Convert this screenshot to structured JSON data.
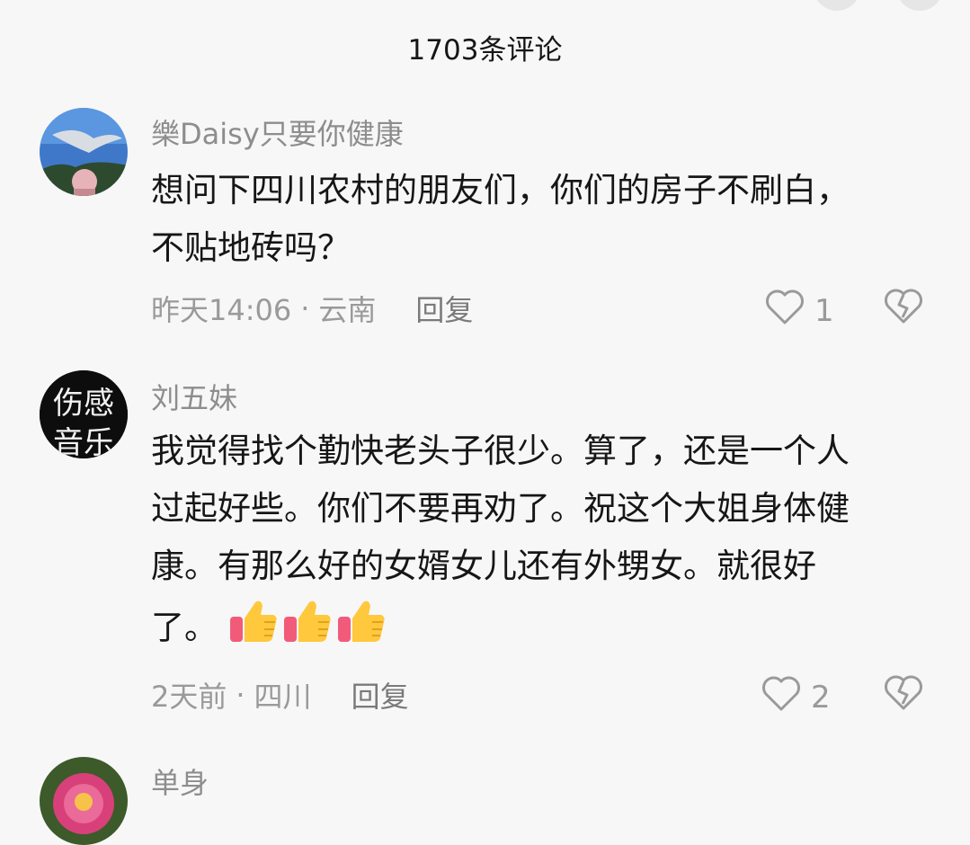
{
  "header": {
    "title": "1703条评论"
  },
  "comments": [
    {
      "username": "樂Daisy只要你健康",
      "lines": [
        "想问下四川农村的朋友们，你们的房子不刷白，",
        "不贴地砖吗？"
      ],
      "time": "昨天14:06",
      "location": "云南",
      "reply_label": "回复",
      "likes": "1"
    },
    {
      "username": "刘五妹",
      "avatar_text": "伤感音乐",
      "lines": [
        "我觉得找个勤快老头子很少。算了，还是一个人",
        "过起好些。你们不要再劝了。祝这个大姐身体健",
        "康。有那么好的女婿女儿还有外甥女。就很好",
        "了。"
      ],
      "emoji_icon": "thumbs-up-icon",
      "emoji_count": 3,
      "time": "2天前",
      "location": "四川",
      "reply_label": "回复",
      "likes": "2"
    },
    {
      "username": "单身"
    }
  ]
}
